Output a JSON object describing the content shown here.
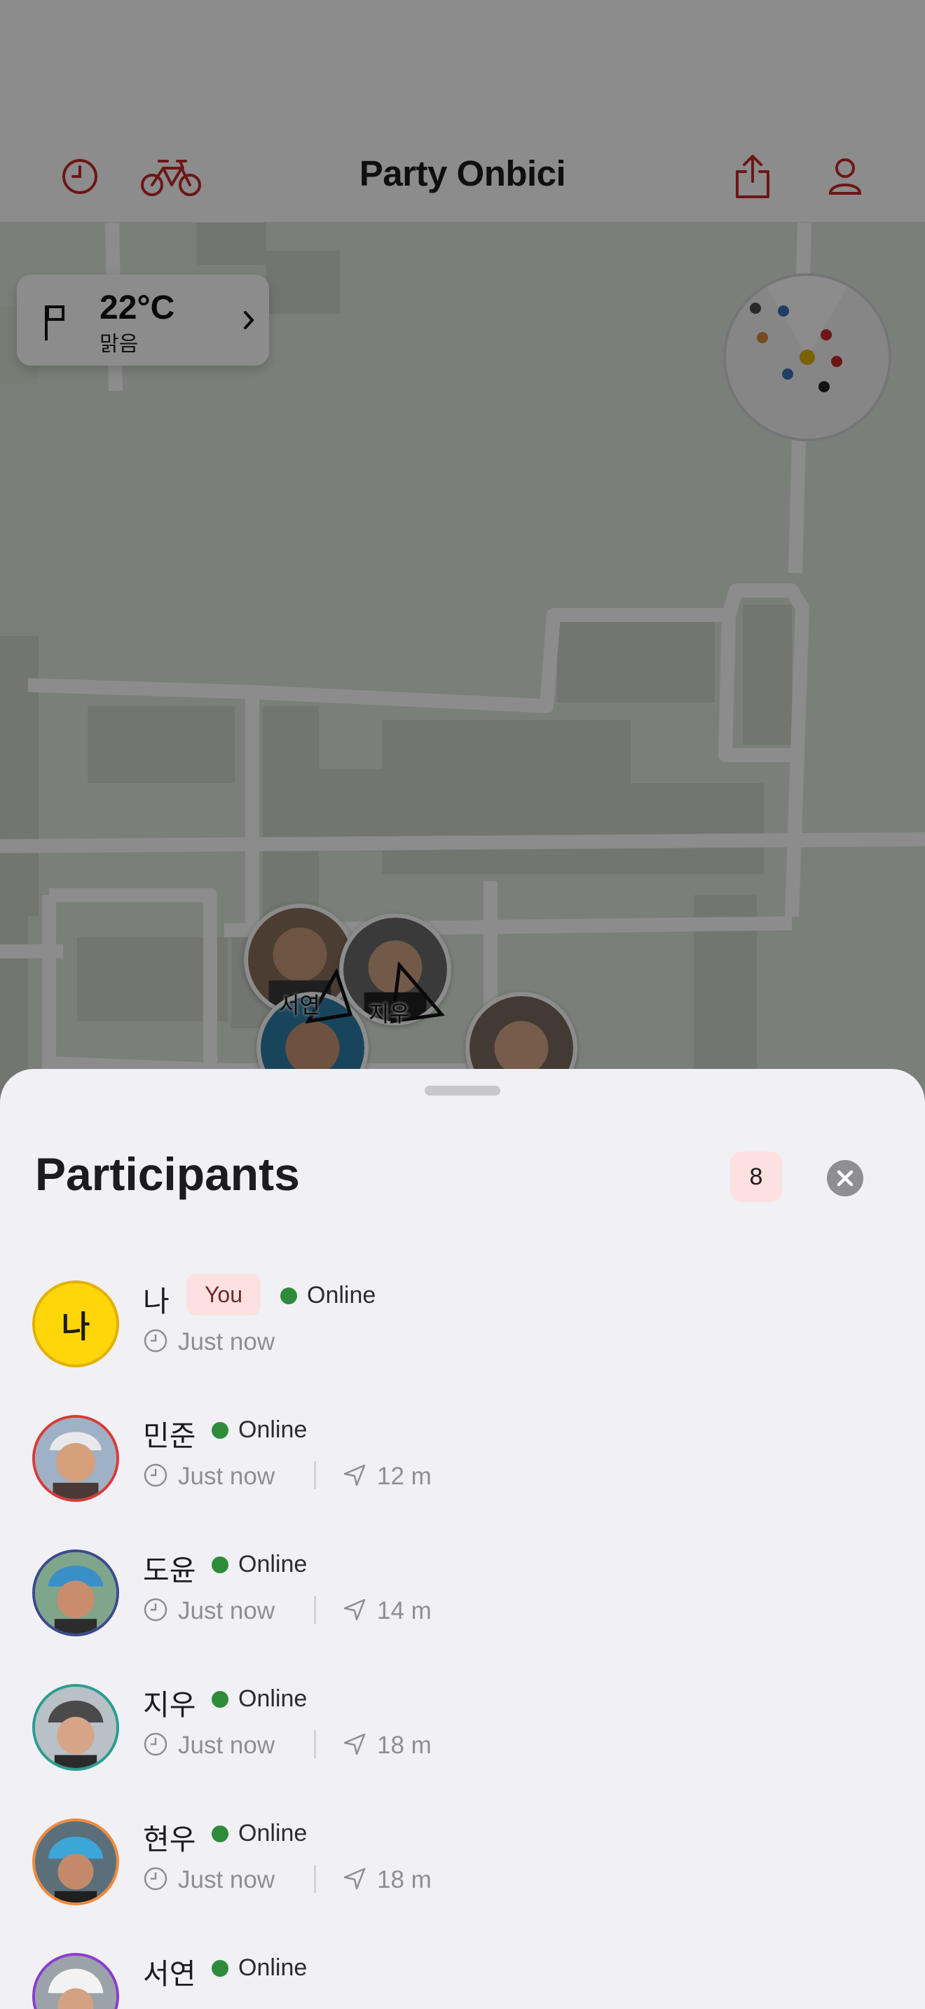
{
  "header": {
    "title": "Party Onbici",
    "left_icons": [
      "clock-icon",
      "bicycle-icon"
    ],
    "right_icons": [
      "share-icon",
      "person-icon"
    ],
    "accent_color": "#c62828"
  },
  "weather": {
    "temperature": "22°C",
    "condition": "맑음",
    "icon": "flag-icon"
  },
  "map_markers": [
    {
      "label": "서연"
    },
    {
      "label": "지우"
    }
  ],
  "sheet": {
    "title": "Participants",
    "count": "8",
    "you_label": "You",
    "online_label": "Online"
  },
  "participants": [
    {
      "name": "나",
      "initial": "나",
      "is_you": true,
      "status": "Online",
      "time": "Just now",
      "distance": "",
      "ring_color": "#e2b100"
    },
    {
      "name": "민준",
      "status": "Online",
      "time": "Just now",
      "distance": "12 m",
      "ring_color": "#d93a3a"
    },
    {
      "name": "도윤",
      "status": "Online",
      "time": "Just now",
      "distance": "14 m",
      "ring_color": "#3a4a8f"
    },
    {
      "name": "지우",
      "status": "Online",
      "time": "Just now",
      "distance": "18 m",
      "ring_color": "#2a9d8f"
    },
    {
      "name": "현우",
      "status": "Online",
      "time": "Just now",
      "distance": "18 m",
      "ring_color": "#f08a3c"
    },
    {
      "name": "서연",
      "status": "Online",
      "time": "",
      "distance": "",
      "ring_color": "#8a3ccf"
    }
  ]
}
